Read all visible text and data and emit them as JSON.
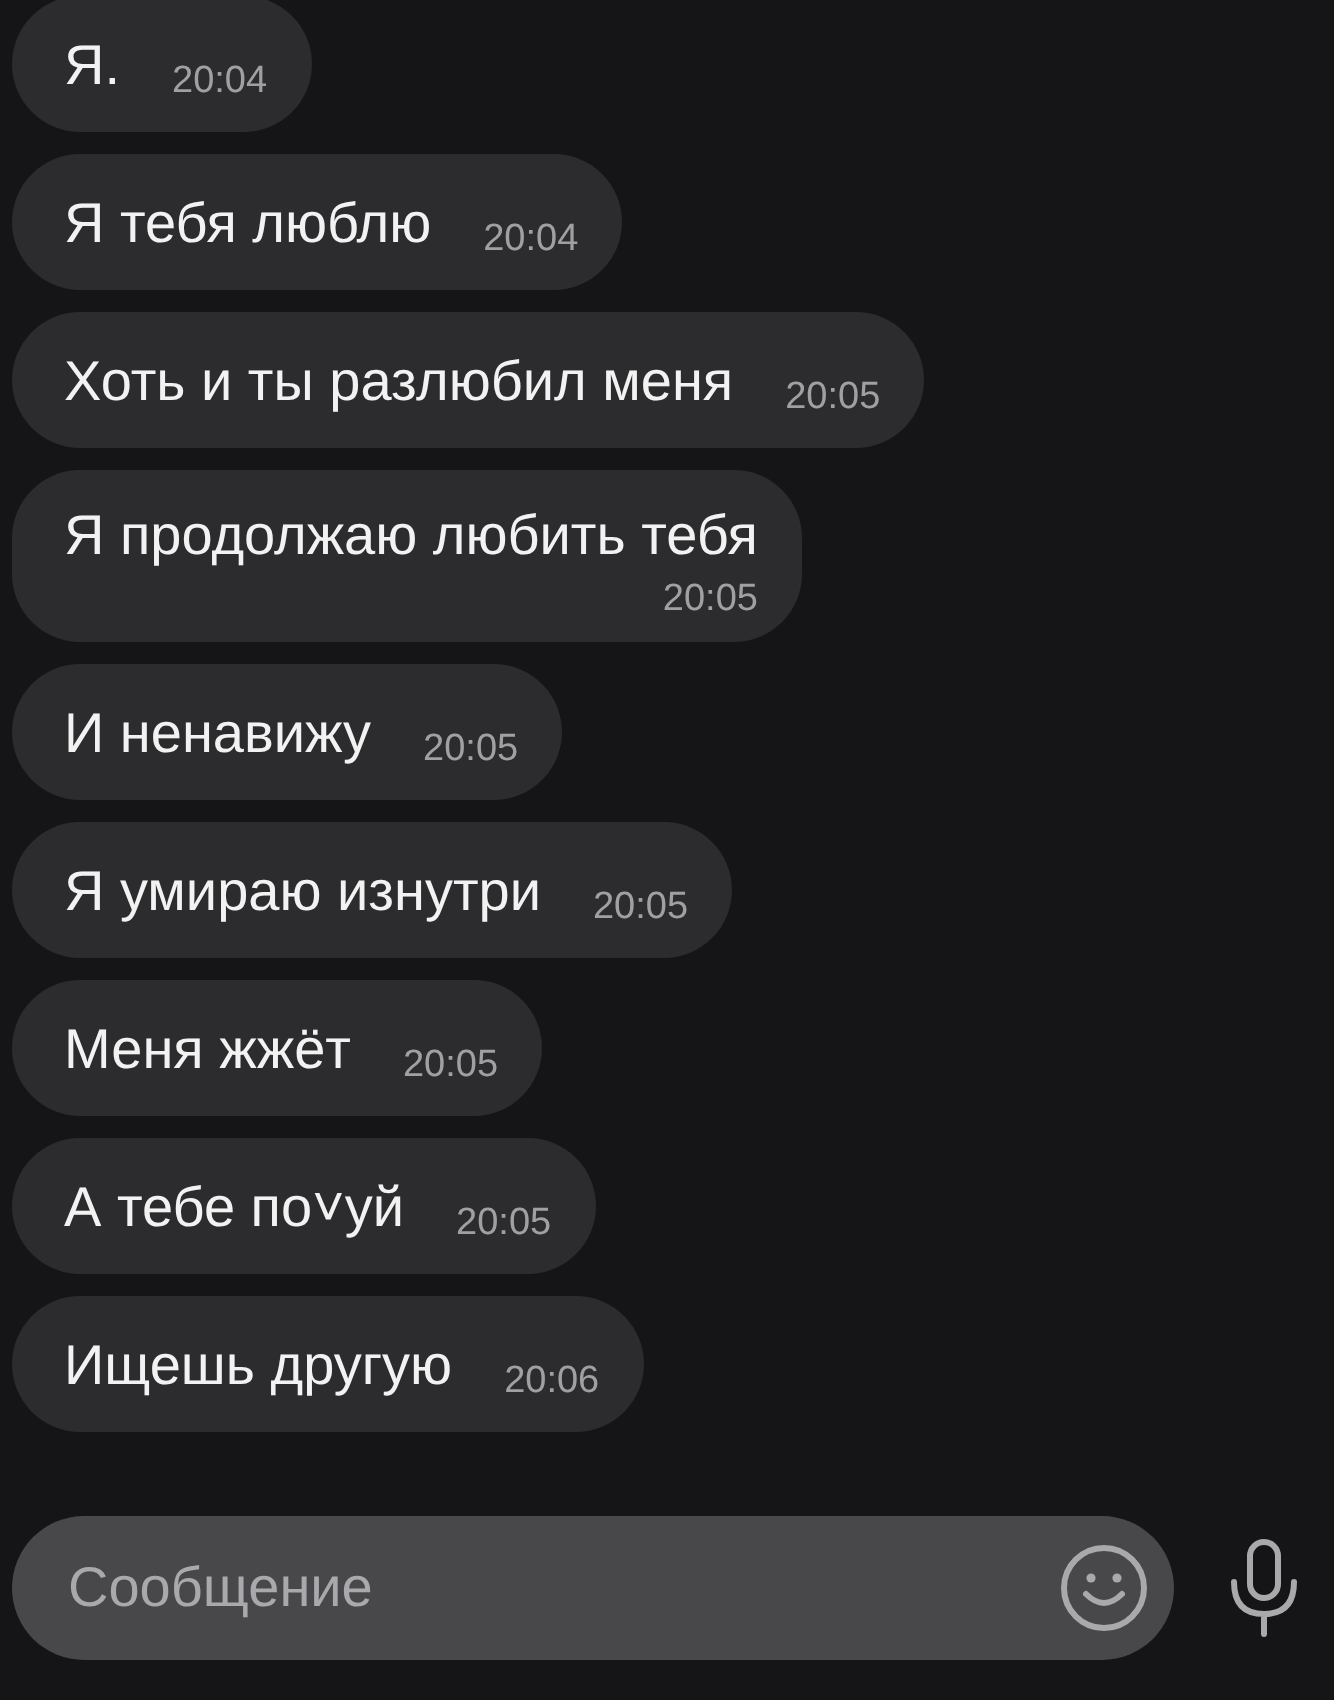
{
  "messages": [
    {
      "text": "Я.",
      "time": "20:04",
      "kind": "inline"
    },
    {
      "text": "Я тебя люблю",
      "time": "20:04",
      "kind": "inline"
    },
    {
      "text": "Хоть и ты разлюбил меня",
      "time": "20:05",
      "kind": "inline"
    },
    {
      "text": "Я продолжаю любить тебя",
      "time": "20:05",
      "kind": "stacked"
    },
    {
      "text": "И ненавижу",
      "time": "20:05",
      "kind": "inline"
    },
    {
      "text": "Я умираю изнутри",
      "time": "20:05",
      "kind": "inline"
    },
    {
      "text": "Меня жжёт",
      "time": "20:05",
      "kind": "inline"
    },
    {
      "text": "А тебе по˅уй",
      "time": "20:05",
      "kind": "inline"
    },
    {
      "text": "Ищешь другую",
      "time": "20:06",
      "kind": "inline"
    }
  ],
  "composer": {
    "placeholder": "Сообщение"
  }
}
